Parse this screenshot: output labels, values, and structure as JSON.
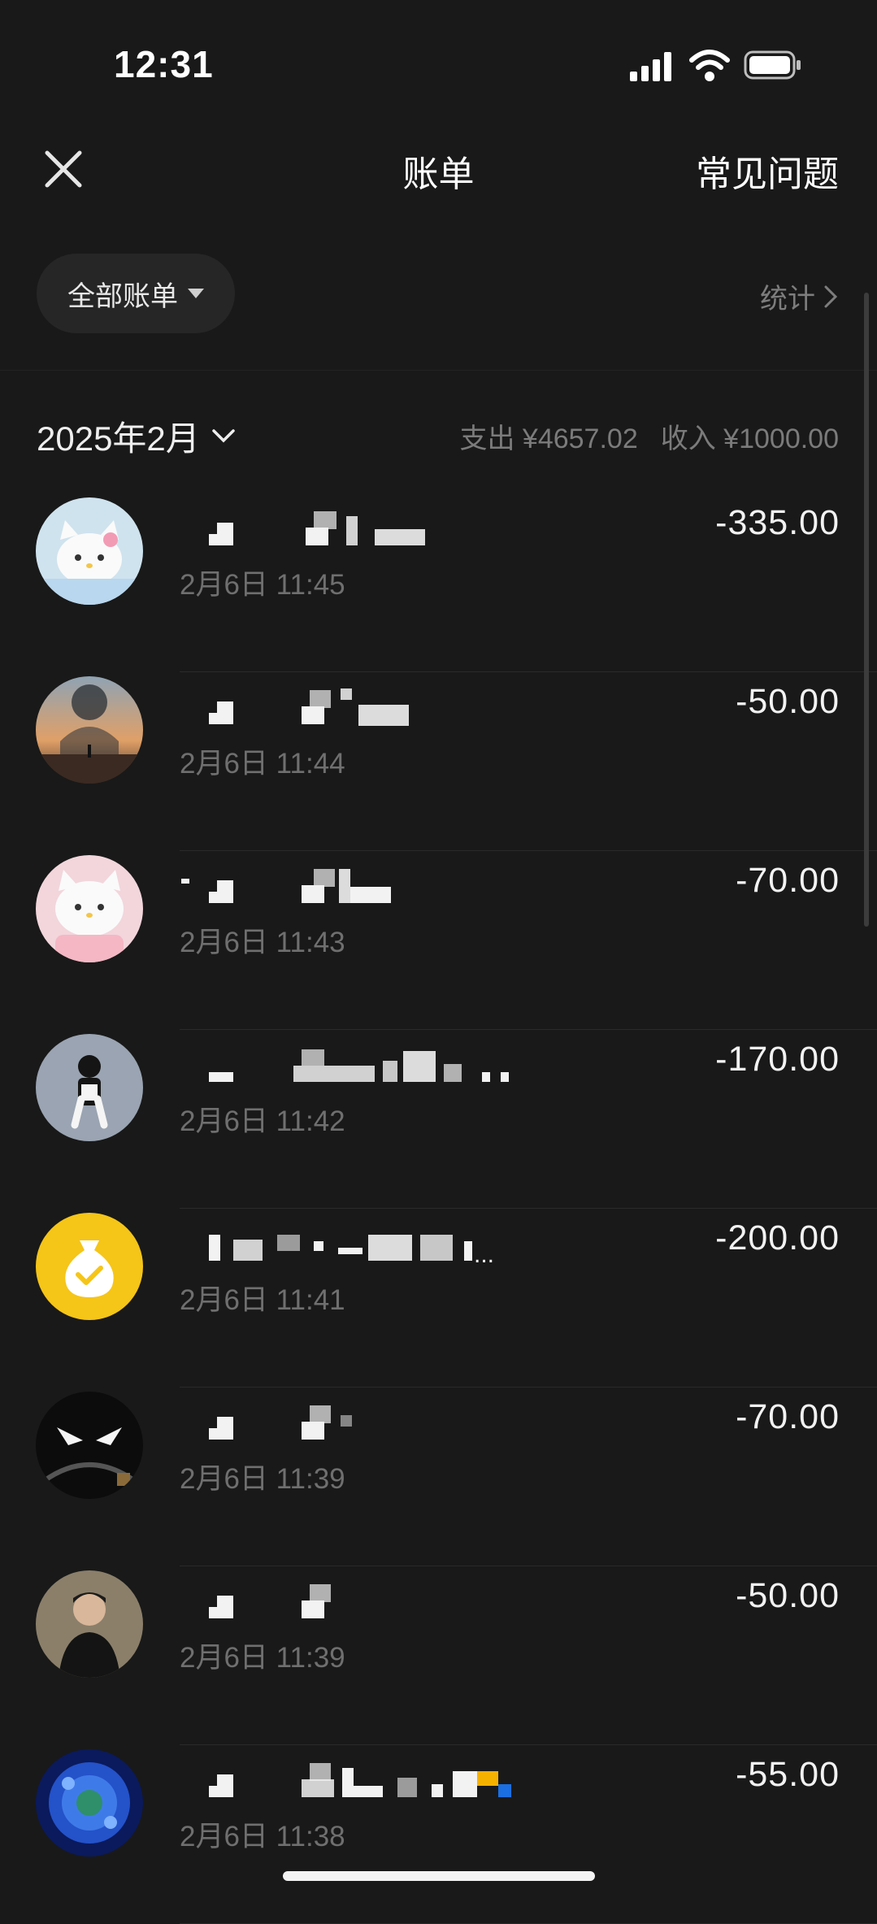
{
  "status_bar": {
    "time": "12:31"
  },
  "nav": {
    "title": "账单",
    "faq": "常见问题"
  },
  "filter": {
    "label": "全部账单",
    "stats": "统计"
  },
  "month": {
    "label": "2025年2月",
    "expense": "支出 ¥4657.02",
    "income": "收入 ¥1000.00"
  },
  "transactions": [
    {
      "time": "2月6日 11:45",
      "amount": "-335.00",
      "avatar": "cat-avatar"
    },
    {
      "time": "2月6日 11:44",
      "amount": "-50.00",
      "avatar": "sunset-person-avatar"
    },
    {
      "time": "2月6日 11:43",
      "amount": "-70.00",
      "avatar": "cat-avatar"
    },
    {
      "time": "2月6日 11:42",
      "amount": "-170.00",
      "avatar": "figure-avatar"
    },
    {
      "time": "2月6日 11:41",
      "amount": "-200.00",
      "avatar": "money-bag-icon"
    },
    {
      "time": "2月6日 11:39",
      "amount": "-70.00",
      "avatar": "dark-cartoon-avatar"
    },
    {
      "time": "2月6日 11:39",
      "amount": "-50.00",
      "avatar": "person-photo-avatar"
    },
    {
      "time": "2月6日 11:38",
      "amount": "-55.00",
      "avatar": "blue-pattern-avatar"
    }
  ],
  "colors": {
    "background": "#191919",
    "money_bag": "#f5c518",
    "secondary_text": "#6f6f6f"
  }
}
